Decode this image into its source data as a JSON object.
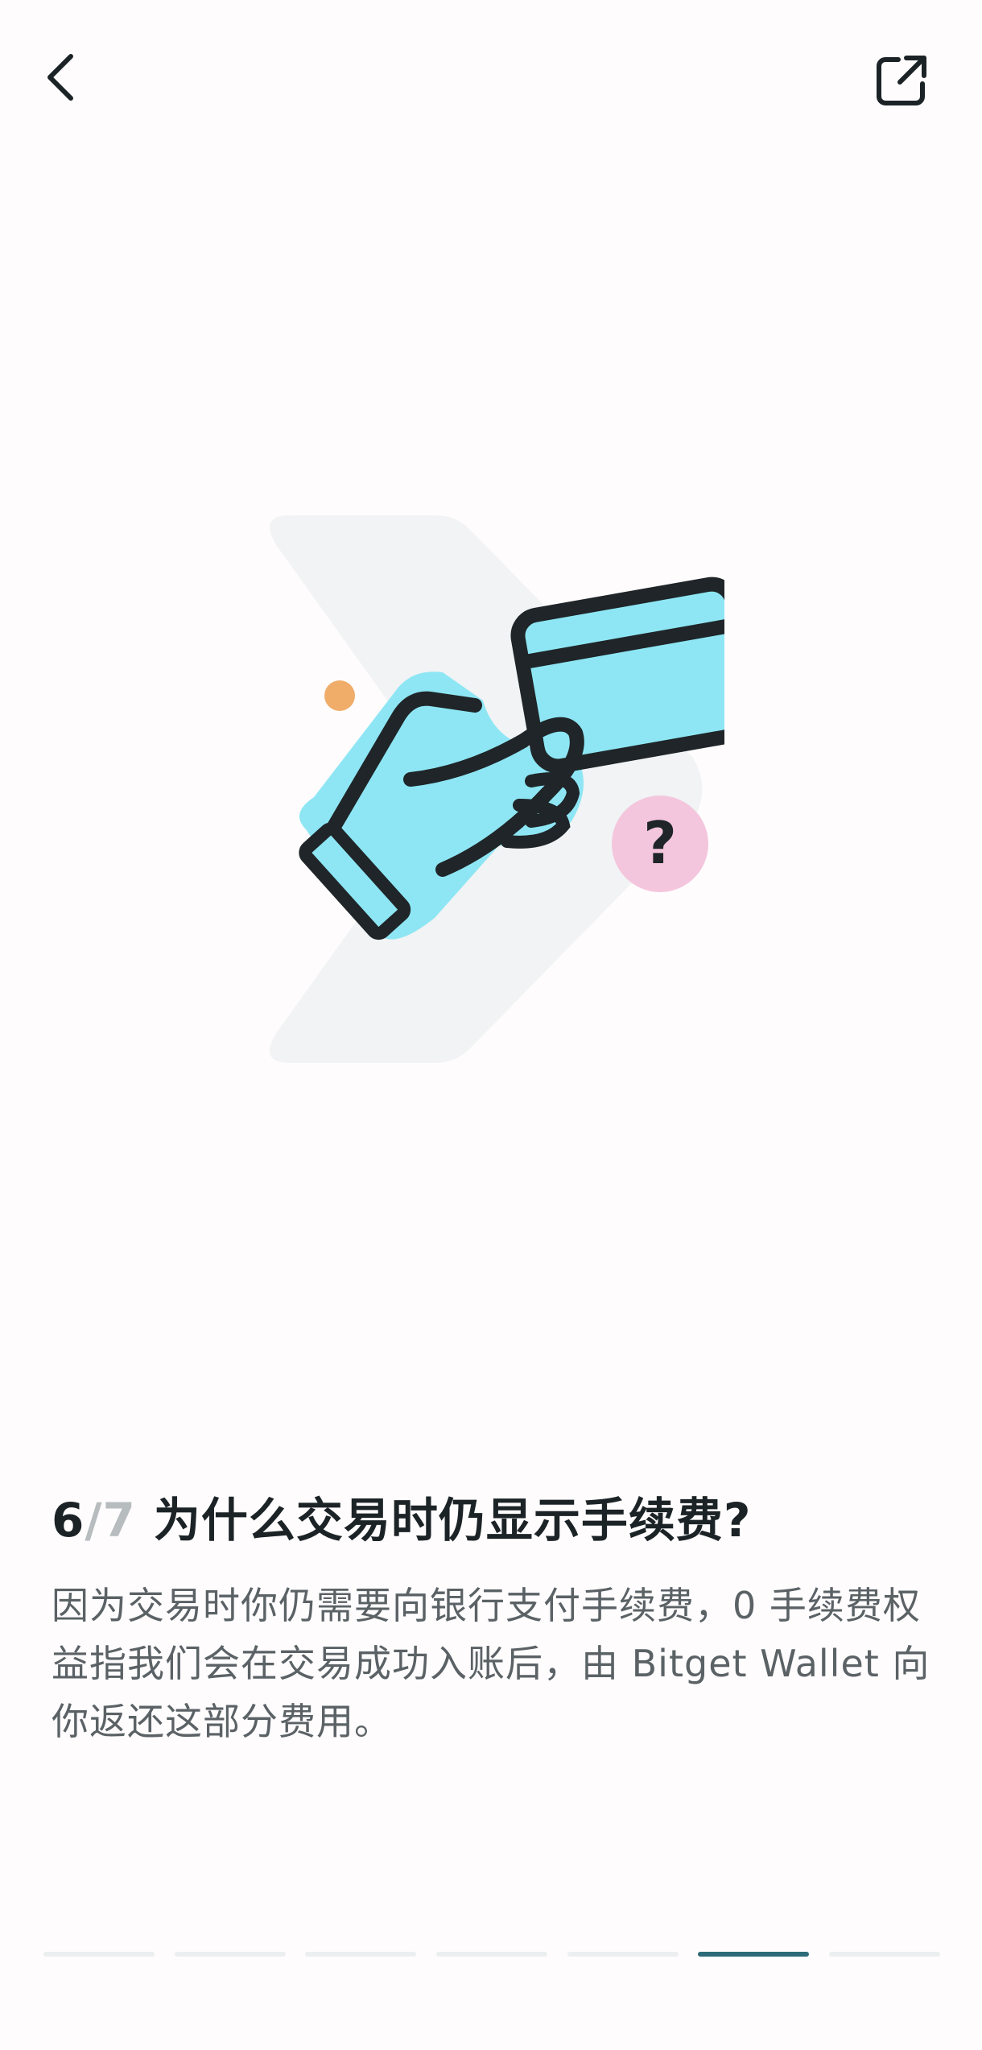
{
  "header": {
    "back_icon": "chevron-left-icon",
    "share_icon": "external-link-icon"
  },
  "illustration": {
    "description_icon": "hand-holding-card-icon",
    "question_mark": "?",
    "colors": {
      "card": "#8ee6f4",
      "outline": "#1f2528",
      "chevron_bg": "#f1f3f4",
      "dot": "#f0ad6a",
      "badge": "#f4c6dd"
    }
  },
  "content": {
    "step_current": "6",
    "step_sep": "/",
    "step_total": "7",
    "title": "为什么交易时仍显示手续费?",
    "description": "因为交易时你仍需要向银行支付手续费，0 手续费权益指我们会在交易成功入账后，由 Bitget Wallet 向你返还这部分费用。"
  },
  "progress": {
    "total": 7,
    "active_index": 5,
    "active_color": "#2c6b78",
    "inactive_color": "#eceff0"
  }
}
